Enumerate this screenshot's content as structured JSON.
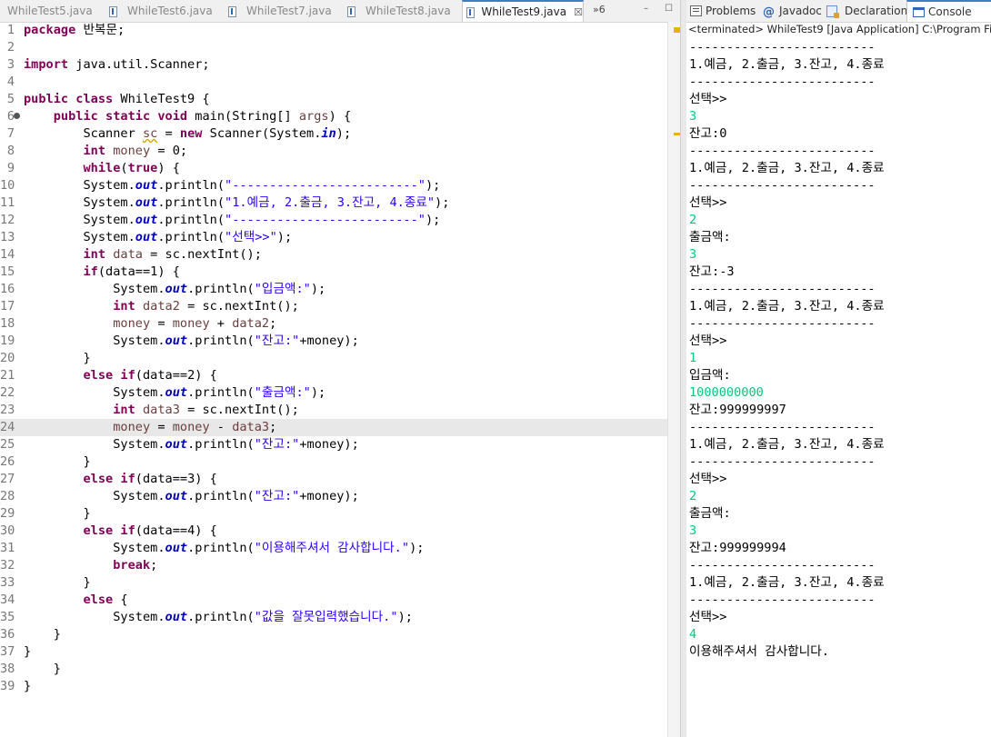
{
  "editor": {
    "tabs": [
      {
        "label": "WhileTest5.java"
      },
      {
        "label": "WhileTest6.java"
      },
      {
        "label": "WhileTest7.java"
      },
      {
        "label": "WhileTest8.java"
      },
      {
        "label": "WhileTest9.java",
        "active": true
      }
    ],
    "close_glyph": "☒",
    "overflow_label": "»6",
    "minimize_glyph": "–",
    "maximize_glyph": "☐",
    "line_numbers": [
      "1",
      "2",
      "3",
      "4",
      "5",
      "6",
      "7",
      "8",
      "9",
      "10",
      "11",
      "12",
      "13",
      "14",
      "15",
      "16",
      "17",
      "18",
      "19",
      "20",
      "21",
      "22",
      "23",
      "24",
      "25",
      "26",
      "27",
      "28",
      "29",
      "30",
      "31",
      "32",
      "33",
      "34",
      "35",
      "36",
      "37",
      "38",
      "39"
    ],
    "code": {
      "package_kw": "package",
      "package_name": " 반복문;",
      "import_kw": "import",
      "import_name": " java.util.Scanner;",
      "public_kw": "public",
      "class_kw": "class",
      "class_name": " WhileTest9 {",
      "static_kw": "static",
      "void_kw": "void",
      "main_sig": " main(String[] ",
      "args_var": "args",
      "main_end": ") {",
      "scanner_type": "Scanner ",
      "sc_var": "sc",
      "eq": " = ",
      "new_kw": "new",
      "scanner_ctor": " Scanner(System.",
      "in_field": "in",
      "ctor_end": ");",
      "int_kw": "int",
      "money_var": "money",
      "zero_init": " = 0;",
      "while_kw": "while",
      "true_kw": "true",
      "while_end": ") {",
      "sys": "System.",
      "out_field": "out",
      "println": ".println(",
      "dashes_str": "\"-------------------------\"",
      "menu_str": "\"1.예금, 2.출금, 3.잔고, 4.종료\"",
      "select_str": "\"선택>>\"",
      "close_paren": ");",
      "data_var": "data",
      "nextint": " = sc.nextInt();",
      "if_kw": "if",
      "cond1": "(data==1) {",
      "cond2": "(data==2) {",
      "cond3": "(data==3) {",
      "cond4": "(data==4) {",
      "deposit_str": "\"입금액:\"",
      "data2_var": "data2",
      "data3_var": "data3",
      "plus_op": " + ",
      "minus_op": " - ",
      "semicolon": ";",
      "balance_str": "\"잔고:\"",
      "plus_money": "+money);",
      "else_kw": "else",
      "withdraw_str": "\"출금액:\"",
      "thanks_str": "\"이용해주셔서 감사합니다.\"",
      "break_kw": "break",
      "else_open": " {",
      "wrong_str": "\"값을 잘못입력했습니다.\"",
      "rbrace": "}"
    }
  },
  "console": {
    "tabs": [
      {
        "label": "Problems",
        "icon": "problems-icon"
      },
      {
        "label": "Javadoc",
        "icon": "javadoc-icon"
      },
      {
        "label": "Declaration",
        "icon": "declaration-icon"
      },
      {
        "label": "Console",
        "icon": "console-icon",
        "active": true
      }
    ],
    "status": "<terminated> WhileTest9 [Java Application] C:\\Program Files\\",
    "lines": [
      {
        "text": "-------------------------"
      },
      {
        "text": "1.예금, 2.출금, 3.잔고, 4.종료"
      },
      {
        "text": "-------------------------"
      },
      {
        "text": "선택>>"
      },
      {
        "text": "3",
        "input": true
      },
      {
        "text": "잔고:0"
      },
      {
        "text": "-------------------------"
      },
      {
        "text": "1.예금, 2.출금, 3.잔고, 4.종료"
      },
      {
        "text": "-------------------------"
      },
      {
        "text": "선택>>"
      },
      {
        "text": "2",
        "input": true
      },
      {
        "text": "출금액:"
      },
      {
        "text": "3",
        "input": true
      },
      {
        "text": "잔고:-3"
      },
      {
        "text": "-------------------------"
      },
      {
        "text": "1.예금, 2.출금, 3.잔고, 4.종료"
      },
      {
        "text": "-------------------------"
      },
      {
        "text": "선택>>"
      },
      {
        "text": "1",
        "input": true
      },
      {
        "text": "입금액:"
      },
      {
        "text": "1000000000",
        "input": true
      },
      {
        "text": "잔고:999999997"
      },
      {
        "text": "-------------------------"
      },
      {
        "text": "1.예금, 2.출금, 3.잔고, 4.종료"
      },
      {
        "text": "-------------------------"
      },
      {
        "text": "선택>>"
      },
      {
        "text": "2",
        "input": true
      },
      {
        "text": "출금액:"
      },
      {
        "text": "3",
        "input": true
      },
      {
        "text": "잔고:999999994"
      },
      {
        "text": "-------------------------"
      },
      {
        "text": "1.예금, 2.출금, 3.잔고, 4.종료"
      },
      {
        "text": "-------------------------"
      },
      {
        "text": "선택>>"
      },
      {
        "text": "4",
        "input": true
      },
      {
        "text": "이용해주셔서 감사합니다."
      }
    ]
  },
  "colors": {
    "keyword": "#7f0055",
    "string": "#2a00ff",
    "field": "#0000c0",
    "variable": "#6a3e3e",
    "console_input": "#00c87d",
    "current_line": "#e8e8e8"
  }
}
